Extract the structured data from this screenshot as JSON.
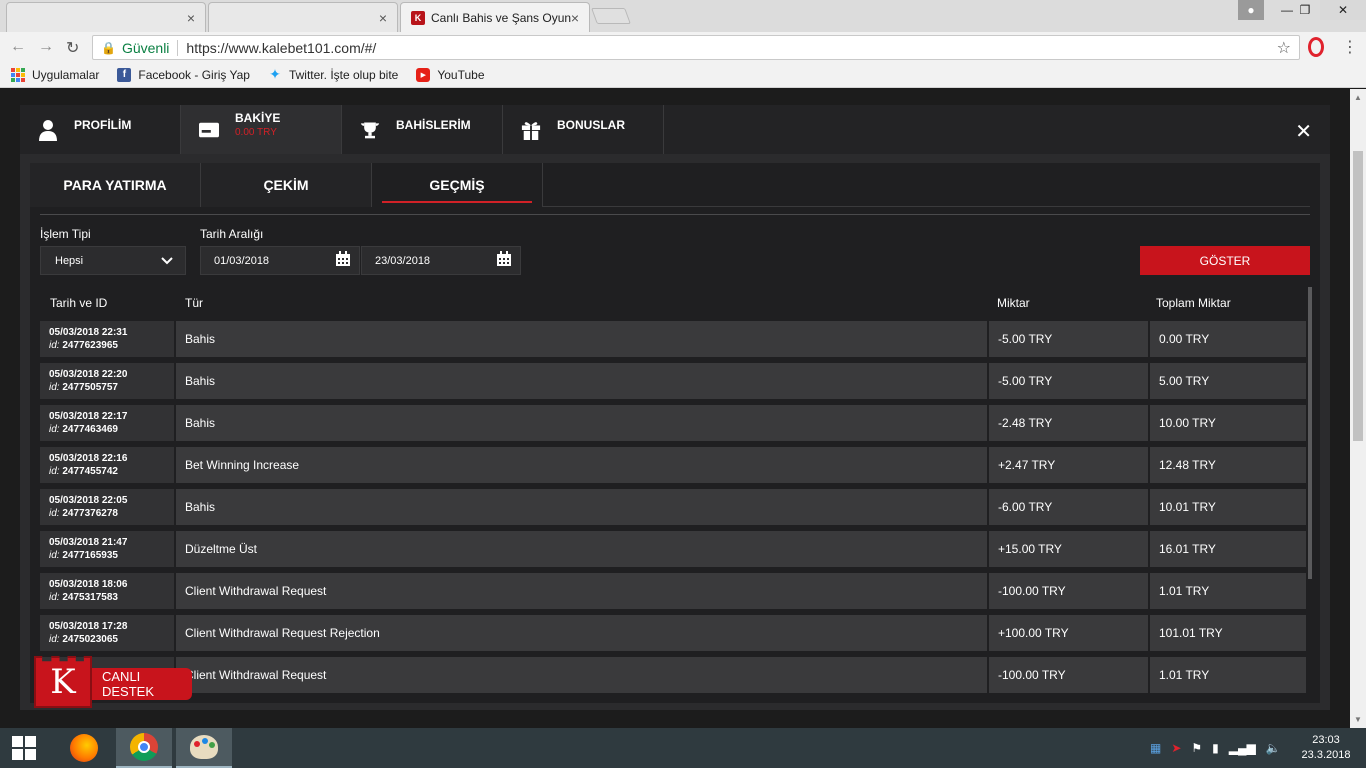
{
  "browser": {
    "tabs": [
      {
        "title": "",
        "close": "×"
      },
      {
        "title": "",
        "close": "×"
      },
      {
        "title": "Canlı Bahis ve Şans Oyun",
        "close": "×"
      }
    ],
    "secure_label": "Güvenli",
    "url": "https://www.kalebet101.com/#/",
    "bookmarks": [
      {
        "label": "Uygulamalar",
        "icon": "apps-grid-icon"
      },
      {
        "label": "Facebook - Giriş Yap",
        "icon": "facebook-icon"
      },
      {
        "label": "Twitter. İşte olup bite",
        "icon": "twitter-icon"
      },
      {
        "label": "YouTube",
        "icon": "youtube-icon"
      }
    ]
  },
  "modal": {
    "tabs": [
      {
        "label": "PROFİLİM",
        "sub": "",
        "icon": "user-icon"
      },
      {
        "label": "BAKİYE",
        "sub": "0.00 TRY",
        "icon": "wallet-icon"
      },
      {
        "label": "BAHİSLERİM",
        "sub": "",
        "icon": "trophy-icon"
      },
      {
        "label": "BONUSLAR",
        "sub": "",
        "icon": "gift-icon"
      }
    ],
    "subtabs": [
      "PARA YATIRMA",
      "ÇEKİM",
      "GEÇMİŞ"
    ],
    "filters": {
      "type_label": "İşlem Tipi",
      "type_value": "Hepsi",
      "date_label": "Tarih Aralığı",
      "date_from": "01/03/2018",
      "date_to": "23/03/2018",
      "show_button": "GÖSTER"
    },
    "table": {
      "headers": [
        "Tarih ve ID",
        "Tür",
        "Miktar",
        "Toplam Miktar"
      ],
      "id_prefix": "id:",
      "rows": [
        {
          "date": "05/03/2018 22:31",
          "id": "2477623965",
          "type": "Bahis",
          "amount": "-5.00 TRY",
          "total": "0.00 TRY"
        },
        {
          "date": "05/03/2018 22:20",
          "id": "2477505757",
          "type": "Bahis",
          "amount": "-5.00 TRY",
          "total": "5.00 TRY"
        },
        {
          "date": "05/03/2018 22:17",
          "id": "2477463469",
          "type": "Bahis",
          "amount": "-2.48 TRY",
          "total": "10.00 TRY"
        },
        {
          "date": "05/03/2018 22:16",
          "id": "2477455742",
          "type": "Bet Winning Increase",
          "amount": "+2.47 TRY",
          "total": "12.48 TRY"
        },
        {
          "date": "05/03/2018 22:05",
          "id": "2477376278",
          "type": "Bahis",
          "amount": "-6.00 TRY",
          "total": "10.01 TRY"
        },
        {
          "date": "05/03/2018 21:47",
          "id": "2477165935",
          "type": "Düzeltme Üst",
          "amount": "+15.00 TRY",
          "total": "16.01 TRY"
        },
        {
          "date": "05/03/2018 18:06",
          "id": "2475317583",
          "type": "Client Withdrawal Request",
          "amount": "-100.00 TRY",
          "total": "1.01 TRY"
        },
        {
          "date": "05/03/2018 17:28",
          "id": "2475023065",
          "type": "Client Withdrawal Request Rejection",
          "amount": "+100.00 TRY",
          "total": "101.01 TRY"
        },
        {
          "date": "",
          "id": "",
          "type": "Client Withdrawal Request",
          "amount": "-100.00 TRY",
          "total": "1.01 TRY"
        }
      ]
    }
  },
  "chat_widget": {
    "letter": "K",
    "label": "CANLI DESTEK"
  },
  "taskbar": {
    "time": "23:03",
    "date": "23.3.2018"
  },
  "colors": {
    "accent": "#c8141c",
    "panel": "#2b2b2d",
    "row": "#3a3a3c"
  }
}
